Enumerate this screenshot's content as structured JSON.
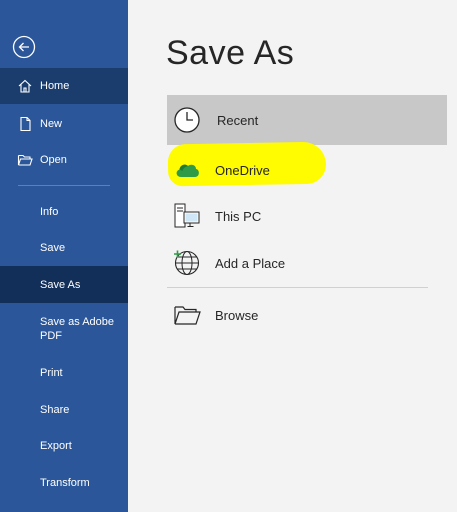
{
  "sidebar": {
    "items": [
      {
        "label": "Home",
        "icon": "home-icon"
      },
      {
        "label": "New",
        "icon": "new-document-icon"
      },
      {
        "label": "Open",
        "icon": "open-folder-icon"
      },
      {
        "label": "Info"
      },
      {
        "label": "Save"
      },
      {
        "label": "Save As"
      },
      {
        "label": "Save as Adobe\nPDF"
      },
      {
        "label": "Print"
      },
      {
        "label": "Share"
      },
      {
        "label": "Export"
      },
      {
        "label": "Transform"
      }
    ]
  },
  "main": {
    "title": "Save As",
    "locations": [
      {
        "label": "Recent",
        "icon": "clock-icon"
      },
      {
        "label": "OneDrive",
        "icon": "onedrive-cloud-icon"
      },
      {
        "label": "This PC",
        "icon": "this-pc-icon"
      },
      {
        "label": "Add a Place",
        "icon": "add-place-globe-icon"
      },
      {
        "label": "Browse",
        "icon": "browse-folder-icon"
      }
    ]
  },
  "colors": {
    "sidebar_bg": "#2b579a",
    "highlight": "#fffb00",
    "onedrive_green": "#2e9b46"
  }
}
